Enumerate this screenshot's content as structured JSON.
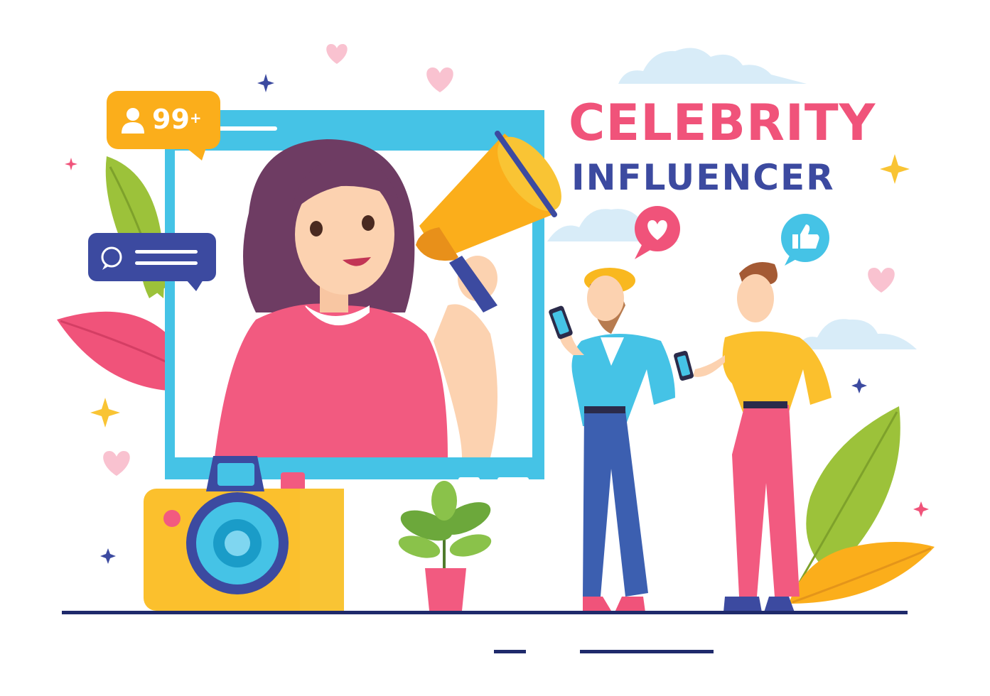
{
  "title": {
    "line1": "CELEBRITY",
    "line2": "INFLUENCER"
  },
  "follower_badge": {
    "count": "99",
    "suffix": "+"
  },
  "colors": {
    "pink": "#f0537a",
    "navy": "#3c4aa0",
    "sky": "#45c3e6",
    "orange": "#fbae1b",
    "yellow": "#f9c434",
    "green": "#9cc23a",
    "soft_pink": "#f9c2d0",
    "cloud": "#d7ecf7"
  },
  "icons": [
    "user-icon",
    "chat-bubble-icon",
    "heart-icon",
    "thumbs-up-icon",
    "sparkle-icon",
    "megaphone-icon",
    "camera-icon",
    "plant-icon",
    "smartphone-icon",
    "cloud-icon",
    "leaf-icon"
  ]
}
